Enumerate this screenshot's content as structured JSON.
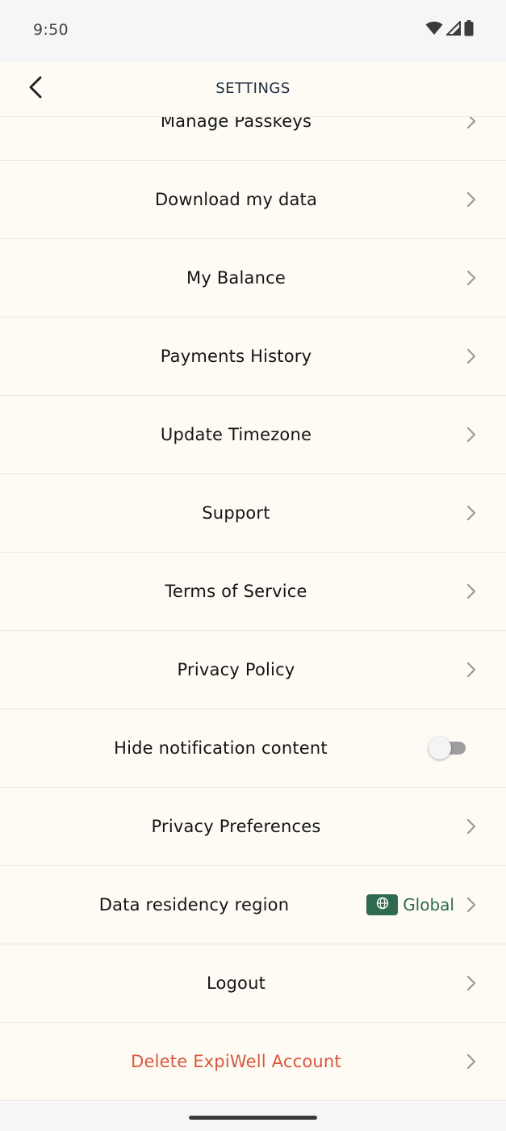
{
  "status_bar": {
    "time": "9:50",
    "icons": [
      "wifi-icon",
      "cell-signal-icon",
      "battery-icon"
    ]
  },
  "header": {
    "title": "SETTINGS",
    "back_icon": "chevron-left-icon"
  },
  "settings": {
    "items": [
      {
        "label": "Manage Passkeys",
        "name": "manage-passkeys"
      },
      {
        "label": "Download my data",
        "name": "download-my-data"
      },
      {
        "label": "My Balance",
        "name": "my-balance"
      },
      {
        "label": "Payments History",
        "name": "payments-history"
      },
      {
        "label": "Update Timezone",
        "name": "update-timezone"
      },
      {
        "label": "Support",
        "name": "support"
      },
      {
        "label": "Terms of Service",
        "name": "terms-of-service"
      },
      {
        "label": "Privacy Policy",
        "name": "privacy-policy"
      },
      {
        "label": "Hide notification content",
        "name": "hide-notification-content",
        "toggle": false
      },
      {
        "label": "Privacy Preferences",
        "name": "privacy-preferences"
      },
      {
        "label": "Data residency region",
        "name": "data-residency-region",
        "value": "Global",
        "badge_icon": "globe-icon"
      },
      {
        "label": "Logout",
        "name": "logout"
      },
      {
        "label": "Delete ExpiWell Account",
        "name": "delete-account",
        "danger": true
      }
    ]
  },
  "colors": {
    "background": "#fdfbf3",
    "text": "#141414",
    "danger": "#d9573f",
    "accent_green": "#2f6a4f",
    "header_title": "#1f2a44"
  }
}
